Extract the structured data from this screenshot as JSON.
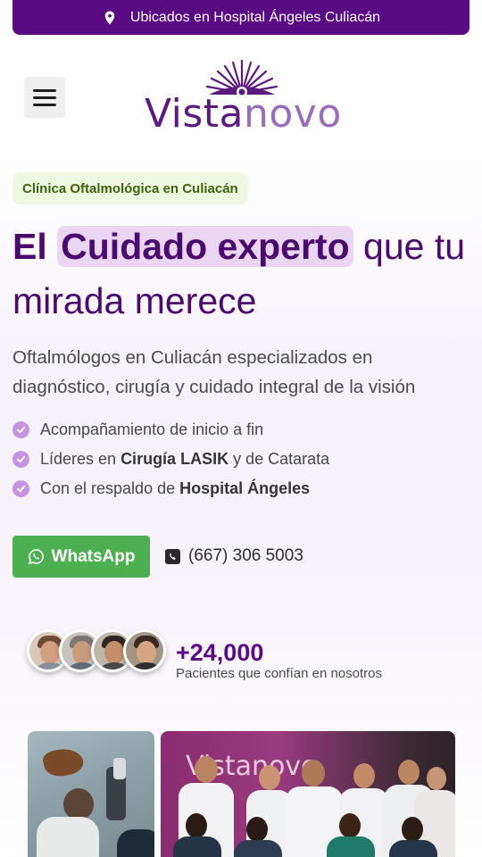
{
  "topbar": {
    "location_icon": "map-pin-icon",
    "text": "Ubicados en Hospital Ángeles Culiacán"
  },
  "header": {
    "menu_icon": "hamburger-menu-icon",
    "logo_part1": "Vista",
    "logo_part2": "novo"
  },
  "hero": {
    "tag": "Clínica Oftalmológica en Culiacán",
    "headline_pre": "El",
    "headline_highlight": "Cuidado experto",
    "headline_post": "que tu mirada merece",
    "subtitle": "Oftalmólogos en Culiacán especializados en diagnóstico, cirugía y cuidado integral de la visión",
    "bullets": [
      {
        "pre": "Acompañamiento de inicio a fin",
        "bold": "",
        "post": ""
      },
      {
        "pre": "Líderes en ",
        "bold": "Cirugía LASIK",
        "post": " y de Catarata"
      },
      {
        "pre": "Con el respaldo de ",
        "bold": "Hospital Ángeles",
        "post": ""
      }
    ],
    "whatsapp_label": "WhatsApp",
    "phone": "(667) 306 5003"
  },
  "social_proof": {
    "count": "+24,000",
    "label": "Pacientes que confían en nosotros"
  },
  "photos": {
    "brand_sign": "Vistanovo"
  },
  "colors": {
    "brand": "#5a0a82",
    "whatsapp": "#4caf50",
    "check": "#c594e0",
    "tag_bg": "#eef7df",
    "highlight_bg": "#ead6f3"
  }
}
